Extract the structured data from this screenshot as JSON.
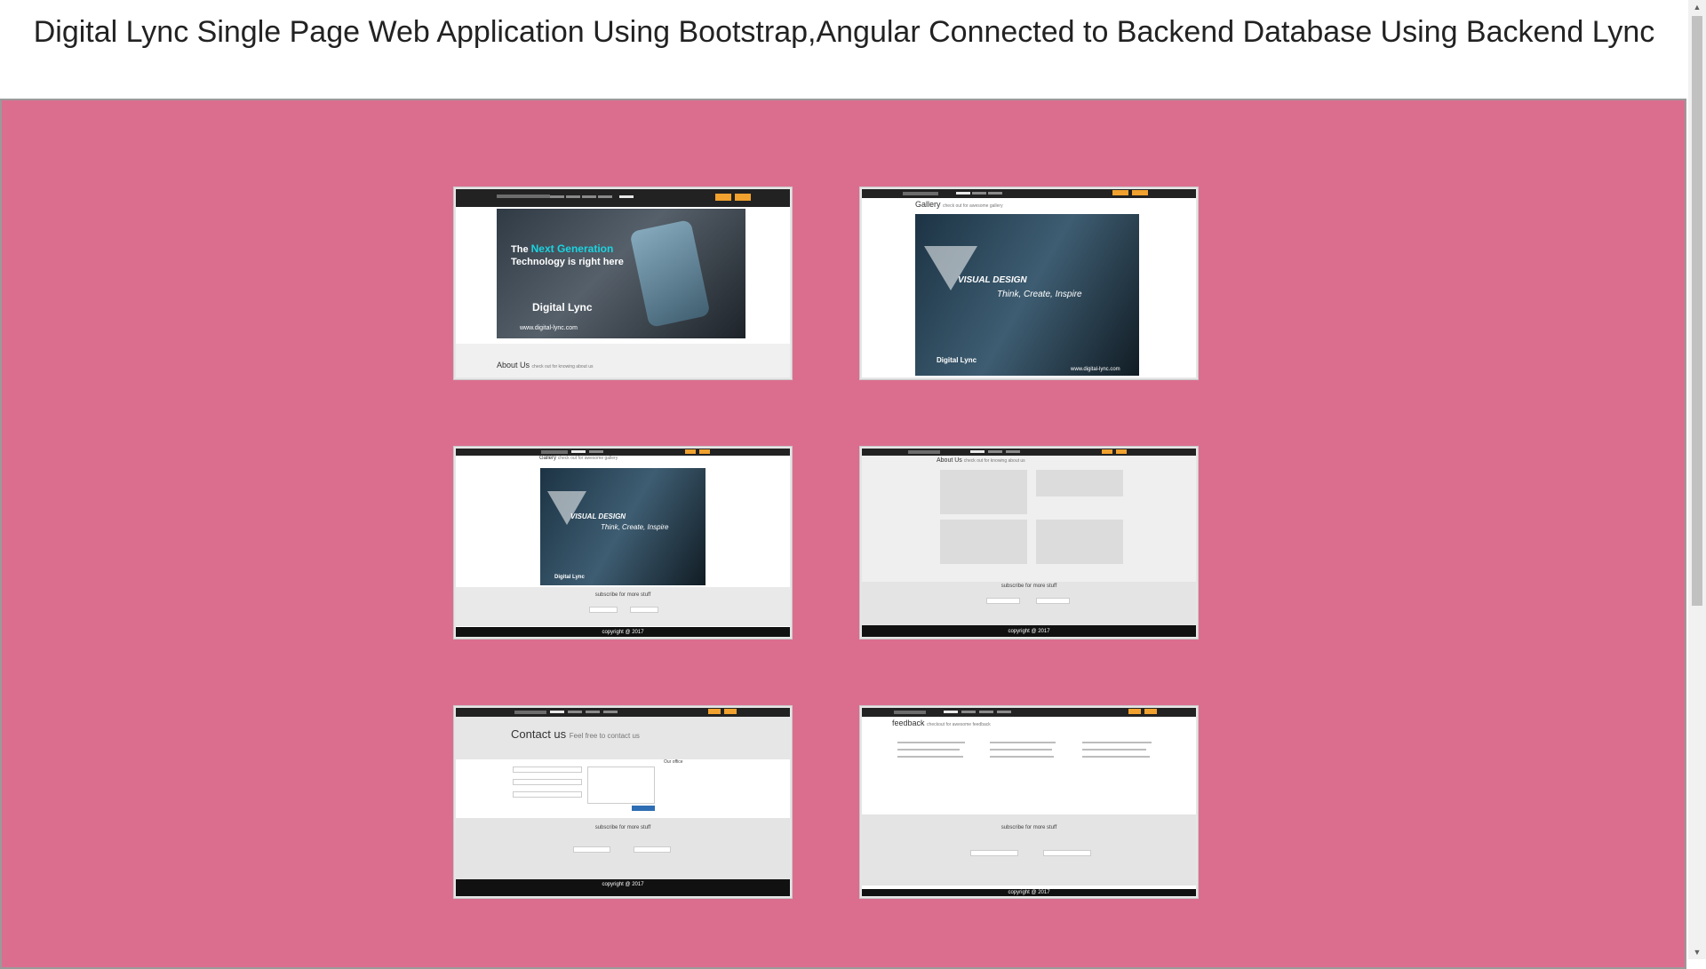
{
  "page": {
    "title": "Digital Lync Single Page Web Application Using Bootstrap,Angular Connected to Backend Database Using Backend Lync"
  },
  "colors": {
    "background": "#db6e8f",
    "nav": "#222222",
    "nav_button": "#f0a12e",
    "accent_text": "#1bd3e0"
  },
  "thumbnails": [
    {
      "name": "home",
      "hero_line1": "The",
      "hero_accent": "Next Generation",
      "hero_line2": "Technology is right here",
      "brand": "Digital Lync",
      "website": "www.digital-lync.com",
      "section_title": "About Us",
      "section_subtitle": "check out for knowing about us"
    },
    {
      "name": "gallery",
      "section_title": "Gallery",
      "section_subtitle": "check out for awesome gallery",
      "hero_title": "VISUAL DESIGN",
      "hero_subtitle": "Think, Create, Inspire",
      "brand": "Digital Lync",
      "website": "www.digital-lync.com"
    },
    {
      "name": "gallery-scrolled",
      "section_title": "Gallery",
      "section_subtitle": "check out for awesome gallery",
      "hero_title": "VISUAL DESIGN",
      "hero_subtitle": "Think, Create, Inspire",
      "brand": "Digital Lync",
      "subscribe": "subscribe for more stuff",
      "copyright": "copyright @ 2017"
    },
    {
      "name": "about",
      "section_title": "About Us",
      "section_subtitle": "check out for knowing about us",
      "subscribe": "subscribe for more stuff",
      "copyright": "copyright @ 2017"
    },
    {
      "name": "contact",
      "section_title": "Contact us",
      "section_subtitle": "Feel free to contact us",
      "office_label": "Our office",
      "subscribe": "subscribe for more stuff",
      "copyright": "copyright @ 2017"
    },
    {
      "name": "feedback",
      "section_title": "feedback",
      "section_subtitle": "checkout for awesome feedback",
      "subscribe": "subscribe for more stuff",
      "copyright": "copyright @ 2017"
    }
  ],
  "scrollbar": {
    "up_icon": "▲",
    "down_icon": "▼"
  }
}
